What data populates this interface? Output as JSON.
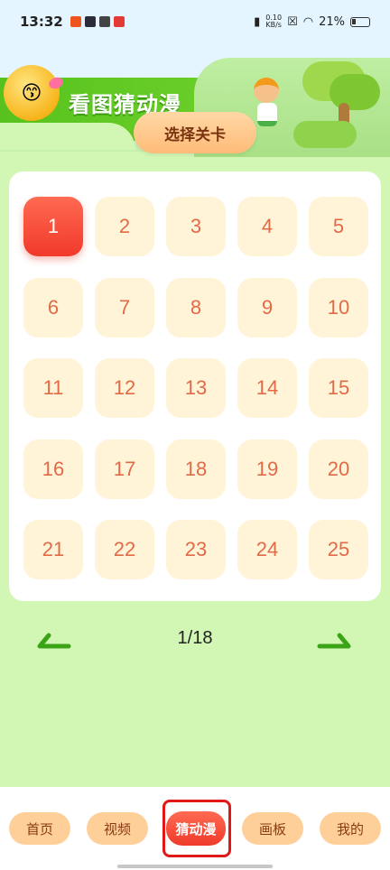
{
  "status_bar": {
    "time": "13:32",
    "net_speed_value": "0.10",
    "net_speed_unit": "KB/s",
    "battery": "21%"
  },
  "header": {
    "title": "看图猜动漫",
    "select_level_label": "选择关卡"
  },
  "levels": {
    "items": [
      "1",
      "2",
      "3",
      "4",
      "5",
      "6",
      "7",
      "8",
      "9",
      "10",
      "11",
      "12",
      "13",
      "14",
      "15",
      "16",
      "17",
      "18",
      "19",
      "20",
      "21",
      "22",
      "23",
      "24",
      "25"
    ],
    "active_index": 0
  },
  "pagination": {
    "indicator": "1/18"
  },
  "bottom_nav": {
    "tabs": [
      {
        "label": "首页"
      },
      {
        "label": "视频"
      },
      {
        "label": "猜动漫"
      },
      {
        "label": "画板"
      },
      {
        "label": "我的"
      }
    ],
    "active_tab": "猜动漫"
  },
  "colors": {
    "accent": "#f1392a",
    "level_tile": "#fff4d8",
    "level_text": "#e26a46",
    "background": "#d2f7b4",
    "tab": "#ffcf9a"
  }
}
